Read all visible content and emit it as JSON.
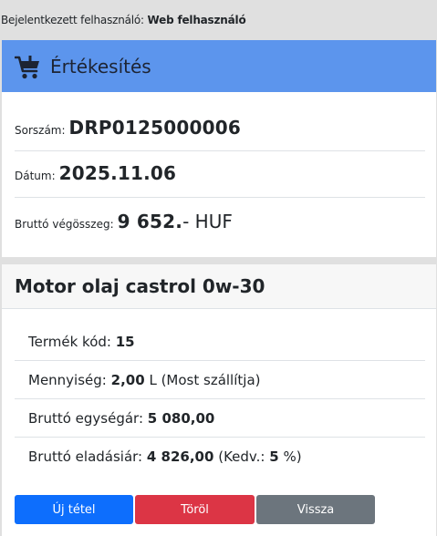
{
  "login": {
    "label": "Bejelentkezett felhasználó:",
    "user": "Web felhasználó"
  },
  "sale": {
    "icon": "shopping-cart-icon",
    "title": "Értékesítés",
    "serial_label": "Sorszám:",
    "serial_value": "DRP0125000006",
    "date_label": "Dátum:",
    "date_value": "2025.11.06",
    "total_label": "Bruttó végösszeg:",
    "total_value": "9 652.",
    "total_suffix": "- HUF"
  },
  "product": {
    "title": "Motor olaj castrol 0w-30",
    "code_label": "Termék kód:",
    "code_value": "15",
    "qty_label": "Mennyiség:",
    "qty_value": "2,00",
    "qty_unit": "L",
    "qty_note": "(Most szállítja)",
    "unit_price_label": "Bruttó egységár:",
    "unit_price_value": "5 080,00",
    "sale_price_label": "Bruttó eladásiár:",
    "sale_price_value": "4 826,00",
    "discount_open": "(Kedv.:",
    "discount_value": "5",
    "discount_close": "%)"
  },
  "buttons": {
    "new_item": "Új tétel",
    "delete": "Töröl",
    "back": "Vissza"
  },
  "colors": {
    "header_blue": "#5c95ed",
    "primary": "#0d6efd",
    "danger": "#dc3545",
    "secondary": "#6c757d"
  }
}
